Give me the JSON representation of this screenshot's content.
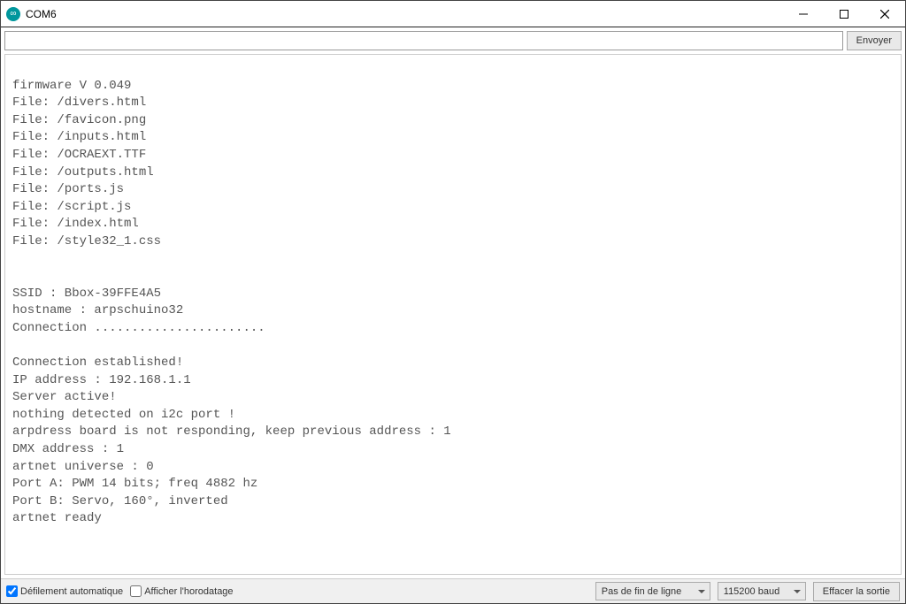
{
  "window": {
    "title": "COM6"
  },
  "toolbar": {
    "input_value": "",
    "send_label": "Envoyer"
  },
  "output": {
    "text": "\nfirmware V 0.049\nFile: /divers.html\nFile: /favicon.png\nFile: /inputs.html\nFile: /OCRAEXT.TTF\nFile: /outputs.html\nFile: /ports.js\nFile: /script.js\nFile: /index.html\nFile: /style32_1.css\n\n\nSSID : Bbox-39FFE4A5\nhostname : arpschuino32\nConnection .......................\n\nConnection established!\nIP address : 192.168.1.1\nServer active!\nnothing detected on i2c port !\narpdress board is not responding, keep previous address : 1\nDMX address : 1\nartnet universe : 0\nPort A: PWM 14 bits; freq 4882 hz\nPort B: Servo, 160°, inverted\nartnet ready"
  },
  "bottombar": {
    "autoscroll_label": "Défilement automatique",
    "autoscroll_checked": true,
    "timestamp_label": "Afficher l'horodatage",
    "timestamp_checked": false,
    "line_ending_selected": "Pas de fin de ligne",
    "baud_selected": "115200 baud",
    "clear_label": "Effacer la sortie"
  }
}
